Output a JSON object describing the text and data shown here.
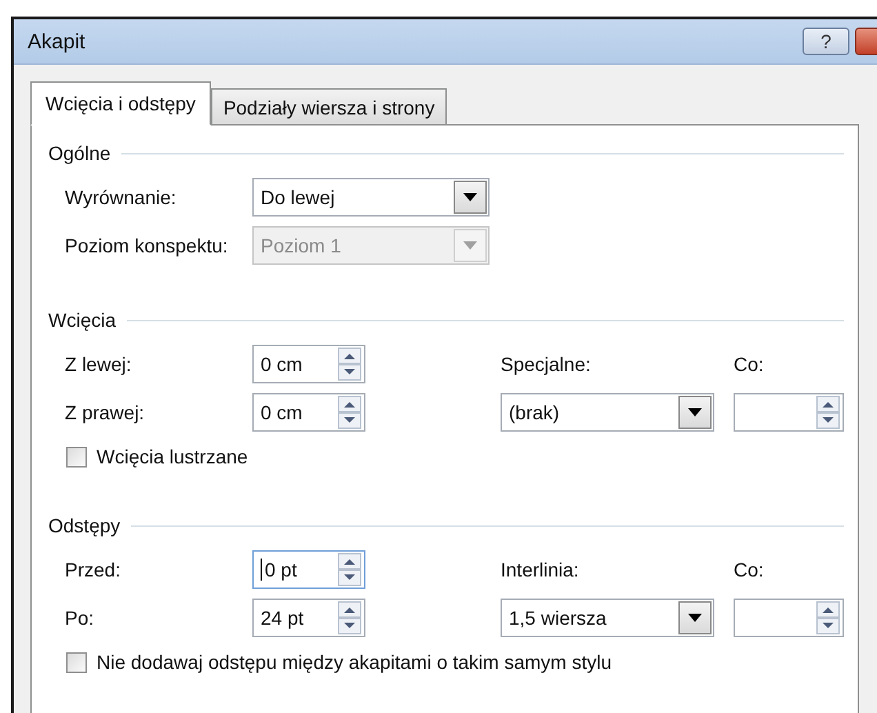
{
  "window": {
    "title": "Akapit",
    "buttons": [
      {
        "kind": "help",
        "label": "?"
      },
      {
        "kind": "close"
      }
    ]
  },
  "tabs": [
    {
      "label": "Wcięcia i odstępy",
      "selected": true
    },
    {
      "label": "Podziały wiersza i strony",
      "selected": false
    }
  ],
  "sections": [
    {
      "heading": "Ogólne",
      "rows": [
        {
          "label": "Wyrównanie:",
          "field": {
            "kind": "combo",
            "value": "Do lewej",
            "disabled": false
          }
        },
        {
          "label": "Poziom konspektu:",
          "field": {
            "kind": "combo",
            "value": "Poziom 1",
            "disabled": true
          }
        }
      ]
    },
    {
      "heading": "Wcięcia",
      "rows": [
        {
          "label": "Z lewej:",
          "field": {
            "kind": "spin",
            "value": "0 cm",
            "focused": false
          }
        },
        {
          "label": "Z prawej:",
          "field": {
            "kind": "spin",
            "value": "0 cm",
            "focused": false
          }
        }
      ],
      "side": {
        "label": "Specjalne:",
        "field": {
          "kind": "combo",
          "value": "(brak)",
          "disabled": false
        },
        "by_label": "Co:",
        "by_field": {
          "kind": "spin"
        }
      },
      "checkbox": {
        "label": "Wcięcia lustrzane",
        "checked": false
      }
    },
    {
      "heading": "Odstępy",
      "rows": [
        {
          "label": "Przed:",
          "field": {
            "kind": "spin",
            "value": "0 pt",
            "focused": true
          }
        },
        {
          "label": "Po:",
          "field": {
            "kind": "spin",
            "value": "24 pt",
            "focused": false
          }
        }
      ],
      "side": {
        "label": "Interlinia:",
        "field": {
          "kind": "combo",
          "value": "1,5 wiersza",
          "disabled": false
        },
        "by_label": "Co:",
        "by_field": {
          "kind": "spin"
        }
      },
      "checkbox": {
        "label": "Nie dodawaj odstępu między akapitami o takim samym stylu",
        "checked": false
      }
    }
  ]
}
